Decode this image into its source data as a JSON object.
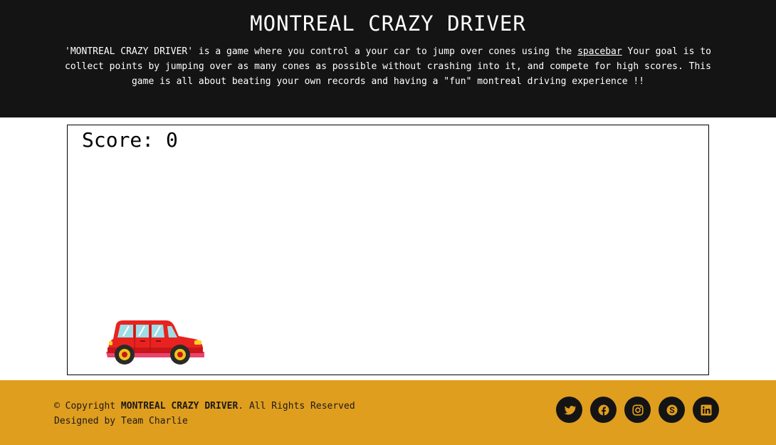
{
  "header": {
    "title": "MONTREAL CRAZY DRIVER",
    "description_before": "'MONTREAL CRAZY DRIVER' is a game where you control a your car to jump over cones using the ",
    "description_key": "spacebar",
    "description_after": " Your goal is to collect points by jumping over as many cones as possible without crashing into it, and compete for high scores. This game is all about beating your own records and having a \"fun\" montreal driving experience !!"
  },
  "game": {
    "score_label": "Score:",
    "score_value": "0"
  },
  "footer": {
    "copyright_prefix": "© Copyright ",
    "copyright_name": "MONTREAL CRAZY DRIVER",
    "copyright_suffix": ". All Rights Reserved",
    "designed_by": "Designed by Team Charlie",
    "socials": [
      {
        "name": "twitter-icon"
      },
      {
        "name": "facebook-icon"
      },
      {
        "name": "instagram-icon"
      },
      {
        "name": "skype-icon"
      },
      {
        "name": "linkedin-icon"
      }
    ]
  },
  "colors": {
    "header_bg": "#141414",
    "footer_bg": "#e09e1e",
    "icon_color": "#e09e1e",
    "car_body": "#e8231f"
  }
}
